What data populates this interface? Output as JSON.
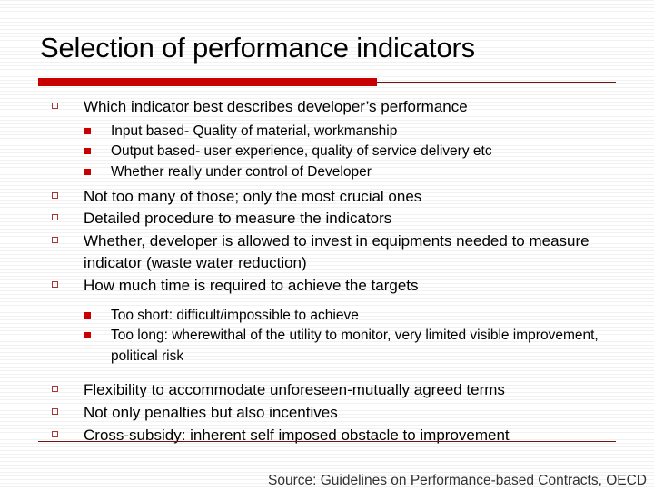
{
  "slide": {
    "title": "Selection of performance indicators",
    "colors": {
      "rule_red": "#CC0000",
      "rule_dark": "#6E1414",
      "bullet_lvl1_outline": "#A33A3A",
      "bullet_lvl2_fill": "#CC0000",
      "text": "#000000",
      "background": "#FFFFFF"
    },
    "bullets": [
      {
        "level": 1,
        "text": "Which indicator best describes developer’s performance"
      },
      {
        "level": 2,
        "text": "Input based- Quality of material, workmanship"
      },
      {
        "level": 2,
        "text": "Output based- user experience, quality of service delivery etc"
      },
      {
        "level": 2,
        "text": "Whether really under control of Developer"
      },
      {
        "level": 1,
        "text": "Not too many of those; only the most crucial ones"
      },
      {
        "level": 1,
        "text": "Detailed procedure to measure the indicators"
      },
      {
        "level": 1,
        "text": "Whether, developer is allowed to invest in equipments needed to measure indicator (waste water reduction)"
      },
      {
        "level": 1,
        "text": "How much time is required to achieve the targets"
      },
      {
        "level": 2,
        "text": "Too short: difficult/impossible to achieve"
      },
      {
        "level": 2,
        "text": "Too long: wherewithal of the utility to monitor, very limited visible improvement, political risk"
      },
      {
        "level": 1,
        "text": "Flexibility to accommodate unforeseen-mutually agreed terms"
      },
      {
        "level": 1,
        "text": "Not only penalties but also incentives"
      },
      {
        "level": 1,
        "text": "Cross-subsidy: inherent self imposed obstacle to improvement"
      }
    ],
    "source": "Source: Guidelines on Performance-based Contracts, OECD"
  }
}
